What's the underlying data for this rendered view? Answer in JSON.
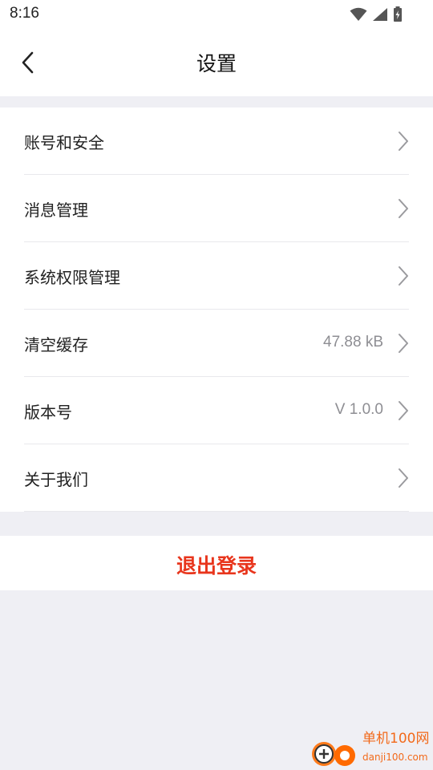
{
  "status_bar": {
    "time": "8:16",
    "icons": [
      "wifi-icon",
      "signal-icon",
      "battery-charging-icon"
    ]
  },
  "header": {
    "title": "设置",
    "back_icon": "chevron-left-icon"
  },
  "menu": {
    "items": [
      {
        "label": "账号和安全",
        "value": ""
      },
      {
        "label": "消息管理",
        "value": ""
      },
      {
        "label": "系统权限管理",
        "value": ""
      },
      {
        "label": "清空缓存",
        "value": "47.88 kB"
      },
      {
        "label": "版本号",
        "value": "V 1.0.0"
      },
      {
        "label": "关于我们",
        "value": ""
      }
    ],
    "chevron_icon": "chevron-right-icon"
  },
  "logout": {
    "label": "退出登录"
  },
  "watermark": {
    "name": "单机100网",
    "url": "danji100.com"
  },
  "colors": {
    "accent_red": "#e8351c",
    "background": "#efeff4",
    "card": "#ffffff",
    "secondary_text": "#8e8e93"
  }
}
